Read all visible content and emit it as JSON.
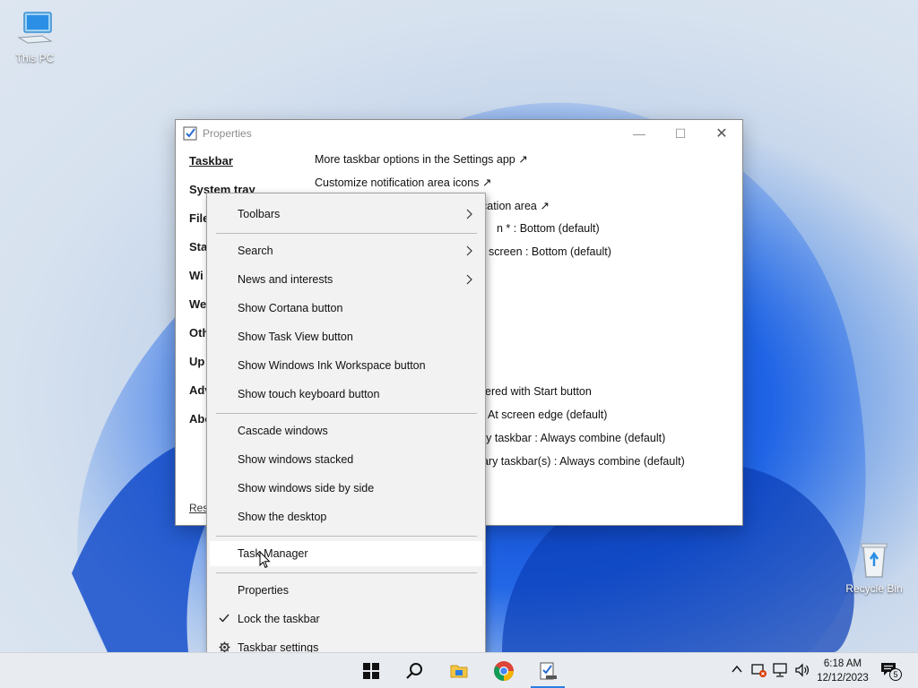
{
  "desktop": {
    "icons": [
      {
        "label": "This PC",
        "icon": "computer-icon"
      },
      {
        "label": "Recycle Bin",
        "icon": "recycle-bin-icon"
      }
    ]
  },
  "window": {
    "title": "Properties",
    "controls": {
      "minimize": "—",
      "maximize": "☐",
      "close": "✕"
    },
    "nav": [
      {
        "label": "Taskbar",
        "active": true
      },
      {
        "label": "System tray"
      },
      {
        "label": "File"
      },
      {
        "label": "Sta"
      },
      {
        "label": "Wi"
      },
      {
        "label": "We"
      },
      {
        "label": "Oth"
      },
      {
        "label": "Up"
      },
      {
        "label": "Adv"
      },
      {
        "label": "Abo"
      }
    ],
    "restore_link": "Rest",
    "content": [
      "More taskbar options in the Settings app ↗",
      "Customize notification area icons ↗",
      "cation area ↗",
      "n * : Bottom (default)",
      "screen : Bottom (default)",
      "ered with Start button",
      "At screen edge (default)",
      "ry taskbar : Always combine (default)",
      "dary taskbar(s) : Always combine (default)"
    ]
  },
  "context_menu": {
    "items": [
      {
        "label": "Toolbars",
        "submenu": true
      },
      {
        "label": "Search",
        "submenu": true
      },
      {
        "label": "News and interests",
        "submenu": true
      },
      {
        "label": "Show Cortana button"
      },
      {
        "label": "Show Task View button"
      },
      {
        "label": "Show Windows Ink Workspace button"
      },
      {
        "label": "Show touch keyboard button"
      },
      {
        "label": "Cascade windows"
      },
      {
        "label": "Show windows stacked"
      },
      {
        "label": "Show windows side by side"
      },
      {
        "label": "Show the desktop"
      },
      {
        "label": "Task Manager",
        "hovered": true
      },
      {
        "label": "Properties"
      },
      {
        "label": "Lock the taskbar",
        "checked": true
      },
      {
        "label": "Taskbar settings",
        "icon": "gear-icon"
      }
    ]
  },
  "taskbar": {
    "pinned": [
      "start-icon",
      "search-icon",
      "file-explorer-icon",
      "chrome-icon",
      "properties-app-icon"
    ],
    "clock": {
      "time": "6:18 AM",
      "date": "12/12/2023"
    },
    "notification_count": "5",
    "accent": "#2a7de1"
  }
}
